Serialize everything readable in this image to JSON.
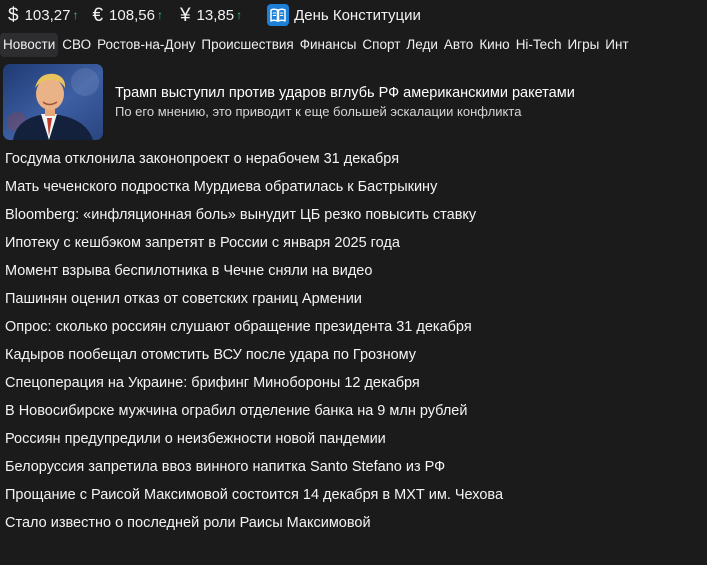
{
  "rates": [
    {
      "symbol": "$",
      "value": "103,27",
      "trend": "↑"
    },
    {
      "symbol": "€",
      "value": "108,56",
      "trend": "↑"
    },
    {
      "symbol": "¥",
      "value": "13,85",
      "trend": "↑"
    }
  ],
  "holiday": {
    "icon": "book-icon",
    "label": "День Конституции"
  },
  "tabs": [
    "Новости",
    "СВО",
    "Ростов-на-Дону",
    "Происшествия",
    "Финансы",
    "Спорт",
    "Леди",
    "Авто",
    "Кино",
    "Hi-Tech",
    "Игры",
    "Инт"
  ],
  "featured": {
    "title": "Трамп выступил против ударов вглубь РФ американскими ракетами",
    "subtitle": "По его мнению, это приводит к еще большей эскалации конфликта"
  },
  "news": [
    "Госдума отклонила законопроект о нерабочем 31 декабря",
    "Мать чеченского подростка Мурдиева обратилась к Бастрыкину",
    "Bloomberg: «инфляционная боль» вынудит ЦБ резко повысить ставку",
    "Ипотеку с кешбэком запретят в России с января 2025 года",
    "Момент взрыва беспилотника в Чечне сняли на видео",
    "Пашинян оценил отказ от советских границ Армении",
    "Опрос: сколько россиян слушают обращение президента 31 декабря",
    "Кадыров пообещал отомстить ВСУ после удара по Грозному",
    "Спецоперация на Украине: брифинг Минобороны 12 декабря",
    "В Новосибирске мужчина ограбил отделение банка на 9 млн рублей",
    "Россиян предупредили о неизбежности новой пандемии",
    "Белоруссия запретила ввоз винного напитка Santo Stefano из РФ",
    "Прощание с Раисой Максимовой состоится 14 декабря в МХТ им. Чехова",
    "Стало известно о последней роли Раисы Максимовой"
  ],
  "colors": {
    "background": "#1b1b1c",
    "trend_up": "#2ecc71",
    "holiday_icon": "#1e7fd7",
    "active_tab": "#2d2d2f"
  }
}
